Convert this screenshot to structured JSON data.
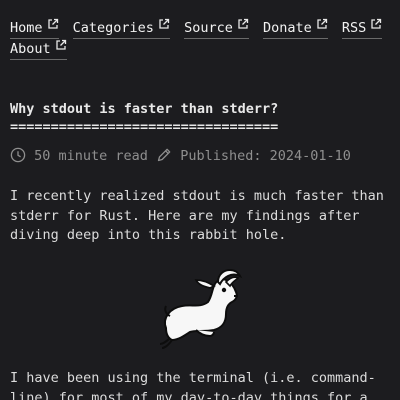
{
  "nav": {
    "items": [
      {
        "label": "Home"
      },
      {
        "label": "Categories"
      },
      {
        "label": "Source"
      },
      {
        "label": "Donate"
      },
      {
        "label": "RSS"
      },
      {
        "label": "About"
      }
    ]
  },
  "article": {
    "title": "Why stdout is faster than stderr?",
    "title_underline": "=================================",
    "read_time": "50 minute read",
    "published": "Published: 2024-01-10",
    "intro": "I recently realized stdout is much faster than stderr for Rust. Here are my findings after diving deep into this rabbit hole.",
    "body_start": "I have been using the terminal (i.e. command-line) for most of my day-to-day things for a"
  },
  "icons": {
    "external": "external-link-icon",
    "clock": "clock-icon",
    "pencil": "pencil-icon",
    "mascot": "goat-mascot-illustration"
  }
}
